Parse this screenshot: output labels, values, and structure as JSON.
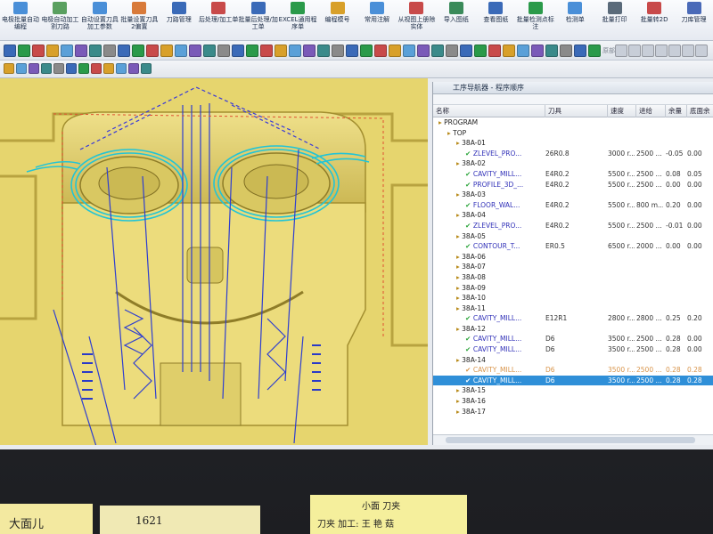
{
  "ribbon": {
    "buttons": [
      {
        "label": "电极批量自动编程",
        "color": "#4a8fd8"
      },
      {
        "label": "电极自动加工割刀路",
        "color": "#5aa060"
      },
      {
        "label": "自动设置刀具加工参数",
        "color": "#4a8fd8"
      },
      {
        "label": "批量设置刀具2偏置",
        "color": "#d87a3a"
      },
      {
        "label": "刀路管理",
        "color": "#3a6ab8"
      },
      {
        "label": "后处理/加工单",
        "color": "#c84a4a"
      },
      {
        "label": "批量后处理/加工单",
        "color": "#3a6ab8"
      },
      {
        "label": "EXCEL通用程序单",
        "color": "#2a9a4a"
      },
      {
        "label": "编程模号",
        "color": "#d8a02a"
      },
      {
        "label": "常用注解",
        "color": "#4a8fd8"
      },
      {
        "label": "从视图上册除实体",
        "color": "#c84a4a"
      },
      {
        "label": "导入图纸",
        "color": "#3a8a5a"
      },
      {
        "label": "查看图纸",
        "color": "#3a6ab8"
      },
      {
        "label": "批量检测点标注",
        "color": "#2a9a4a"
      },
      {
        "label": "检测单",
        "color": "#4a8fd8"
      },
      {
        "label": "批量打印",
        "color": "#5a6a7a"
      },
      {
        "label": "批量转2D",
        "color": "#c84a4a"
      },
      {
        "label": "刀库管理",
        "color": "#4a6ab8"
      }
    ]
  },
  "toolbar": {
    "filter_label": "原部区域"
  },
  "navigator": {
    "title": "工序导航器 - 程序顺序",
    "columns": [
      "名称",
      "刀具",
      "速度",
      "进给",
      "余量",
      "底面余"
    ],
    "rows": [
      {
        "type": "grp",
        "indent": 0,
        "name": "PROGRAM",
        "tool": "",
        "speed": "",
        "feed": "",
        "stock": "",
        "floor": ""
      },
      {
        "type": "grp",
        "indent": 1,
        "name": "TOP",
        "tool": "",
        "speed": "",
        "feed": "",
        "stock": "",
        "floor": ""
      },
      {
        "type": "grp",
        "indent": 2,
        "name": "38A-01",
        "tool": "",
        "speed": "",
        "feed": "",
        "stock": "",
        "floor": ""
      },
      {
        "type": "op",
        "indent": 3,
        "name": "ZLEVEL_PRO...",
        "tool": "26R0.8",
        "speed": "3000 r...",
        "feed": "2500 ...",
        "stock": "-0.05",
        "floor": "0.00"
      },
      {
        "type": "grp",
        "indent": 2,
        "name": "38A-02",
        "tool": "",
        "speed": "",
        "feed": "",
        "stock": "",
        "floor": ""
      },
      {
        "type": "op",
        "indent": 3,
        "name": "CAVITY_MILL...",
        "tool": "E4R0.2",
        "speed": "5500 r...",
        "feed": "2500 ...",
        "stock": "0.08",
        "floor": "0.05"
      },
      {
        "type": "op",
        "indent": 3,
        "name": "PROFILE_3D_...",
        "tool": "E4R0.2",
        "speed": "5500 r...",
        "feed": "2500 ...",
        "stock": "0.00",
        "floor": "0.00"
      },
      {
        "type": "grp",
        "indent": 2,
        "name": "38A-03",
        "tool": "",
        "speed": "",
        "feed": "",
        "stock": "",
        "floor": ""
      },
      {
        "type": "op",
        "indent": 3,
        "name": "FLOOR_WAL...",
        "tool": "E4R0.2",
        "speed": "5500 r...",
        "feed": "800 m...",
        "stock": "0.20",
        "floor": "0.00"
      },
      {
        "type": "grp",
        "indent": 2,
        "name": "38A-04",
        "tool": "",
        "speed": "",
        "feed": "",
        "stock": "",
        "floor": ""
      },
      {
        "type": "op",
        "indent": 3,
        "name": "ZLEVEL_PRO...",
        "tool": "E4R0.2",
        "speed": "5500 r...",
        "feed": "2500 ...",
        "stock": "-0.01",
        "floor": "0.00"
      },
      {
        "type": "grp",
        "indent": 2,
        "name": "38A-05",
        "tool": "",
        "speed": "",
        "feed": "",
        "stock": "",
        "floor": ""
      },
      {
        "type": "op",
        "indent": 3,
        "name": "CONTOUR_T...",
        "tool": "ER0.5",
        "speed": "6500 r...",
        "feed": "2000 ...",
        "stock": "0.00",
        "floor": "0.00"
      },
      {
        "type": "grp",
        "indent": 2,
        "name": "38A-06",
        "tool": "",
        "speed": "",
        "feed": "",
        "stock": "",
        "floor": ""
      },
      {
        "type": "grp",
        "indent": 2,
        "name": "38A-07",
        "tool": "",
        "speed": "",
        "feed": "",
        "stock": "",
        "floor": ""
      },
      {
        "type": "grp",
        "indent": 2,
        "name": "38A-08",
        "tool": "",
        "speed": "",
        "feed": "",
        "stock": "",
        "floor": ""
      },
      {
        "type": "grp",
        "indent": 2,
        "name": "38A-09",
        "tool": "",
        "speed": "",
        "feed": "",
        "stock": "",
        "floor": ""
      },
      {
        "type": "grp",
        "indent": 2,
        "name": "38A-10",
        "tool": "",
        "speed": "",
        "feed": "",
        "stock": "",
        "floor": ""
      },
      {
        "type": "grp",
        "indent": 2,
        "name": "38A-11",
        "tool": "",
        "speed": "",
        "feed": "",
        "stock": "",
        "floor": ""
      },
      {
        "type": "op",
        "indent": 3,
        "name": "CAVITY_MILL...",
        "tool": "E12R1",
        "speed": "2800 r...",
        "feed": "2800 ...",
        "stock": "0.25",
        "floor": "0.20"
      },
      {
        "type": "grp",
        "indent": 2,
        "name": "38A-12",
        "tool": "",
        "speed": "",
        "feed": "",
        "stock": "",
        "floor": ""
      },
      {
        "type": "op",
        "indent": 3,
        "name": "CAVITY_MILL...",
        "tool": "D6",
        "speed": "3500 r...",
        "feed": "2500 ...",
        "stock": "0.28",
        "floor": "0.00"
      },
      {
        "type": "op",
        "indent": 3,
        "name": "CAVITY_MILL...",
        "tool": "D6",
        "speed": "3500 r...",
        "feed": "2500 ...",
        "stock": "0.28",
        "floor": "0.00"
      },
      {
        "type": "grp",
        "indent": 2,
        "name": "38A-14",
        "tool": "",
        "speed": "",
        "feed": "",
        "stock": "",
        "floor": ""
      },
      {
        "type": "dim",
        "indent": 3,
        "name": "CAVITY_MILL...",
        "tool": "D6",
        "speed": "3500 r...",
        "feed": "2500 ...",
        "stock": "0.28",
        "floor": "0.28"
      },
      {
        "type": "sel",
        "indent": 3,
        "name": "CAVITY_MILL...",
        "tool": "D6",
        "speed": "3500 r...",
        "feed": "2500 ...",
        "stock": "0.28",
        "floor": "0.28"
      },
      {
        "type": "grp",
        "indent": 2,
        "name": "38A-15",
        "tool": "",
        "speed": "",
        "feed": "",
        "stock": "",
        "floor": ""
      },
      {
        "type": "grp",
        "indent": 2,
        "name": "38A-16",
        "tool": "",
        "speed": "",
        "feed": "",
        "stock": "",
        "floor": ""
      },
      {
        "type": "grp",
        "indent": 2,
        "name": "38A-17",
        "tool": "",
        "speed": "",
        "feed": "",
        "stock": "",
        "floor": ""
      }
    ]
  },
  "desk": {
    "note_left": "大面儿",
    "note_mid": "1621",
    "note_right_top": "小面 刀夹",
    "note_right_bottom": "刀夹 加工: 王 艳 菇"
  }
}
